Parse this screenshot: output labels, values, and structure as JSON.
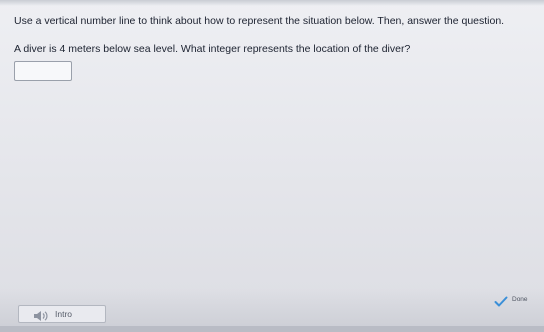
{
  "prompt": {
    "instructions": "Use a vertical number line to think about how to represent the situation below. Then, answer the question.",
    "question": "A diver is 4 meters below sea level. What integer represents the location of the diver?"
  },
  "answer": {
    "value": ""
  },
  "footer": {
    "intro_label": "Intro",
    "done_label": "Done"
  },
  "colors": {
    "check_accent": "#3a8fd8"
  },
  "icons": {
    "intro_icon": "speaker-icon",
    "done_icon": "check-icon"
  }
}
